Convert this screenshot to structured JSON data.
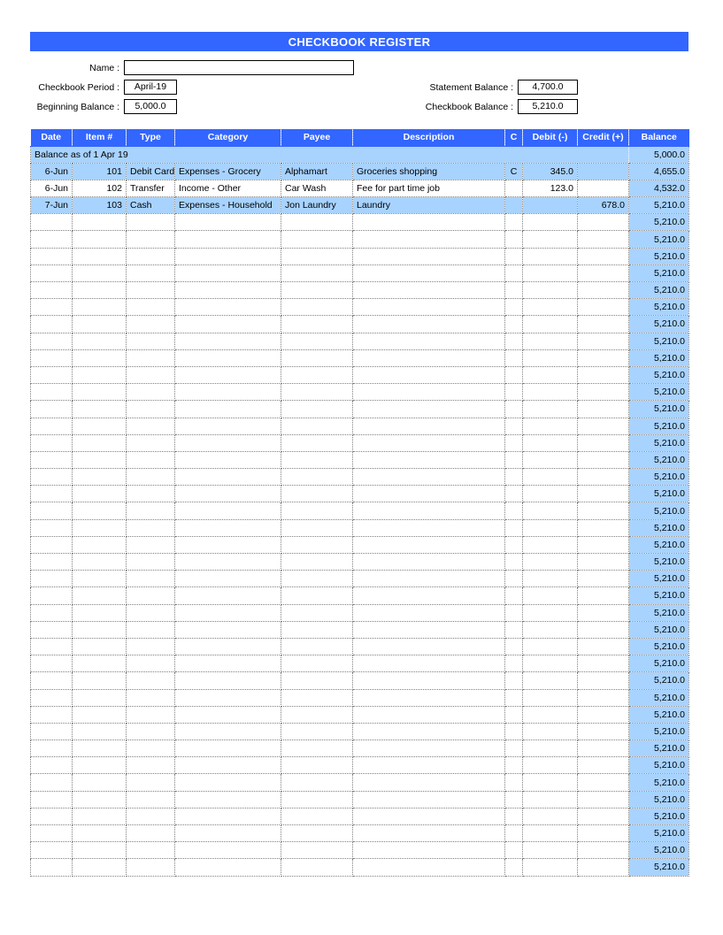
{
  "document": {
    "title": "CHECKBOOK REGISTER"
  },
  "form": {
    "name_label": "Name :",
    "name_value": "",
    "period_label": "Checkbook Period :",
    "period_value": "April-19",
    "beginning_balance_label": "Beginning Balance :",
    "beginning_balance_value": "5,000.0",
    "statement_balance_label": "Statement Balance :",
    "statement_balance_value": "4,700.0",
    "checkbook_balance_label": "Checkbook Balance :",
    "checkbook_balance_value": "5,210.0"
  },
  "register": {
    "columns": [
      "Date",
      "Item #",
      "Type",
      "Category",
      "Payee",
      "Description",
      "C",
      "Debit   (-)",
      "Credit (+)",
      "Balance"
    ],
    "opening": {
      "label": "Balance as of  1 Apr 19",
      "balance": "5,000.0"
    },
    "rows": [
      {
        "date": "6-Jun",
        "item": "101",
        "type": "Debit Card",
        "category": "Expenses - Grocery",
        "payee": "Alphamart",
        "description": "Groceries shopping",
        "cleared": "C",
        "debit": "345.0",
        "credit": "",
        "balance": "4,655.0"
      },
      {
        "date": "6-Jun",
        "item": "102",
        "type": "Transfer",
        "category": "Income - Other",
        "payee": "Car Wash",
        "description": "Fee for part time job",
        "cleared": "",
        "debit": "123.0",
        "credit": "",
        "balance": "4,532.0"
      },
      {
        "date": "7-Jun",
        "item": "103",
        "type": "Cash",
        "category": "Expenses - Household",
        "payee": "Jon Laundry",
        "description": "Laundry",
        "cleared": "",
        "debit": "",
        "credit": "678.0",
        "balance": "5,210.0"
      }
    ],
    "empty_row_balance": "5,210.0",
    "empty_row_count": 39
  },
  "colors": {
    "header_blue": "#3366FF",
    "band_blue": "#A8D3FF",
    "grid": "#808080",
    "text": "#000000"
  }
}
